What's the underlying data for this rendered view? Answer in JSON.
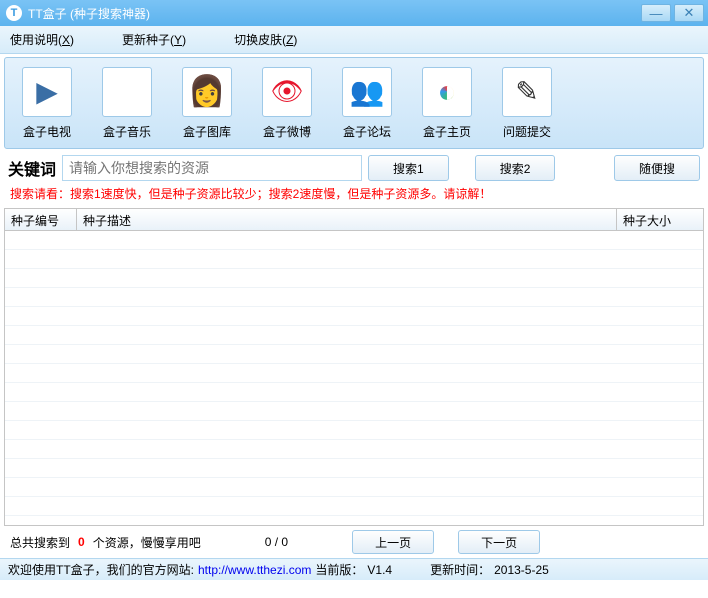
{
  "window": {
    "title": "TT盒子 (种子搜索神器)"
  },
  "menu": {
    "help": {
      "label": "使用说明",
      "accel": "X"
    },
    "update": {
      "label": "更新种子",
      "accel": "Y"
    },
    "skin": {
      "label": "切换皮肤",
      "accel": "Z"
    }
  },
  "toolbar": {
    "tv": "盒子电视",
    "music": "盒子音乐",
    "pic": "盒子图库",
    "weibo": "盒子微博",
    "forum": "盒子论坛",
    "home": "盒子主页",
    "feedback": "问题提交"
  },
  "search": {
    "kw_label": "关键词",
    "placeholder": "请输入你想搜索的资源",
    "btn1": "搜索1",
    "btn2": "搜索2",
    "random": "随便搜"
  },
  "hint": "搜索请看：搜索1速度快，但是种子资源比较少；搜索2速度慢，但是种子资源多。请谅解！",
  "grid": {
    "col_id": "种子编号",
    "col_desc": "种子描述",
    "col_size": "种子大小",
    "rows": []
  },
  "pager": {
    "prefix": "总共搜索到",
    "count": "0",
    "suffix": " 个资源，慢慢享用吧",
    "page_cur": "0",
    "page_sep": " / ",
    "page_total": "0",
    "prev": "上一页",
    "next": "下一页"
  },
  "status": {
    "welcome": "欢迎使用TT盒子，我们的官方网站:",
    "url": "http://www.tthezi.com",
    "version_label": "当前版：",
    "version": "V1.4",
    "update_label": "更新时间：",
    "update_time": "2013-5-25"
  }
}
